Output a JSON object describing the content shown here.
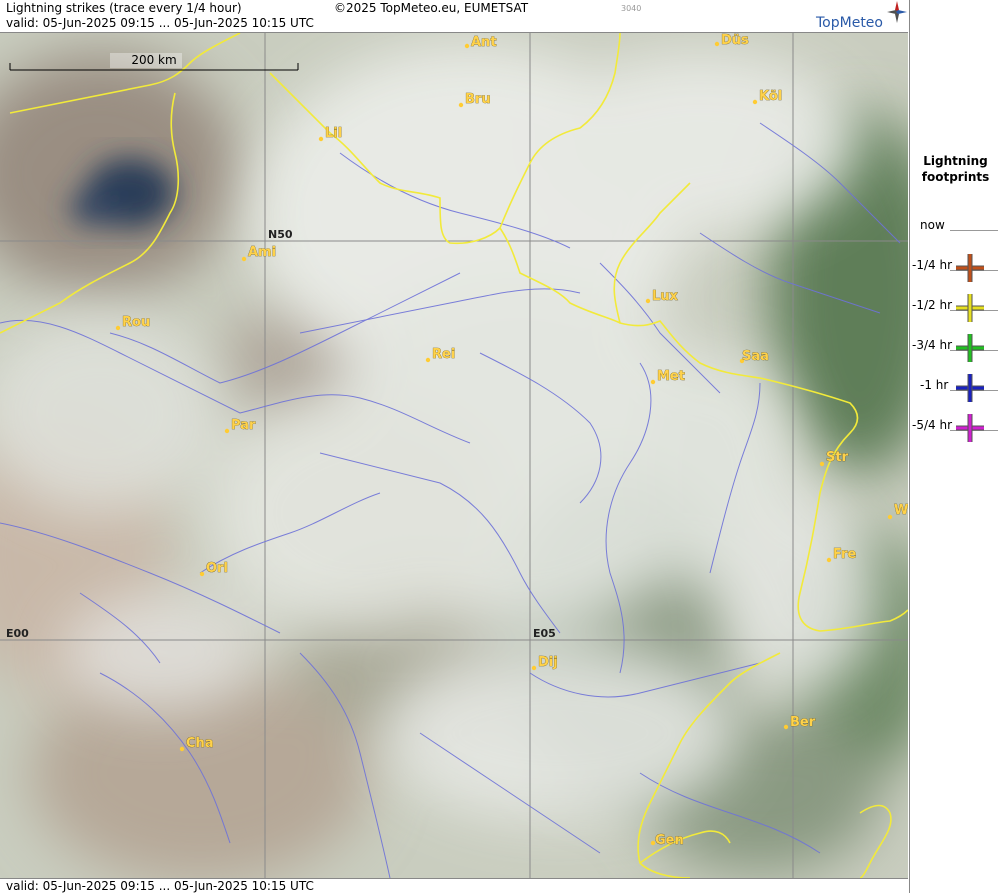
{
  "header": {
    "title": "Lightning strikes (trace every 1/4 hour)",
    "copyright": "©2025 TopMeteo.eu, EUMETSAT",
    "code": "3040",
    "valid": "valid:  05-Jun-2025 09:15 ... 05-Jun-2025 10:15 UTC",
    "logo_text": "TopMeteo"
  },
  "footer": {
    "valid": "valid:  05-Jun-2025 09:15 ... 05-Jun-2025 10:15 UTC"
  },
  "map": {
    "scale_label": "200 km",
    "grid_labels": {
      "lat": "N50",
      "lon0": "E00",
      "lon5": "E05"
    },
    "cities": [
      {
        "name": "Ant"
      },
      {
        "name": "Düs"
      },
      {
        "name": "Bru"
      },
      {
        "name": "Köl"
      },
      {
        "name": "Lil"
      },
      {
        "name": "Ami"
      },
      {
        "name": "Rou"
      },
      {
        "name": "Lux"
      },
      {
        "name": "Rei"
      },
      {
        "name": "Saa"
      },
      {
        "name": "Met"
      },
      {
        "name": "Par"
      },
      {
        "name": "Str"
      },
      {
        "name": "W"
      },
      {
        "name": "Fre"
      },
      {
        "name": "Orl"
      },
      {
        "name": "Dij"
      },
      {
        "name": "Ber"
      },
      {
        "name": "Cha"
      },
      {
        "name": "Gen"
      }
    ]
  },
  "legend": {
    "title_line1": "Lightning",
    "title_line2": "footprints",
    "items": [
      {
        "label": "now",
        "color": ""
      },
      {
        "label": "-1/4 hr",
        "color": "#c0501a"
      },
      {
        "label": "-1/2 hr",
        "color": "#e6e020"
      },
      {
        "label": "-3/4 hr",
        "color": "#22c022"
      },
      {
        "label": "-1 hr",
        "color": "#1a22c0"
      },
      {
        "label": "-5/4 hr",
        "color": "#d020d0"
      }
    ]
  },
  "colors": {
    "border": "#f2ea3a",
    "river": "#6e72d8",
    "grid": "#8a8a8a",
    "city": "#ffcc33"
  }
}
